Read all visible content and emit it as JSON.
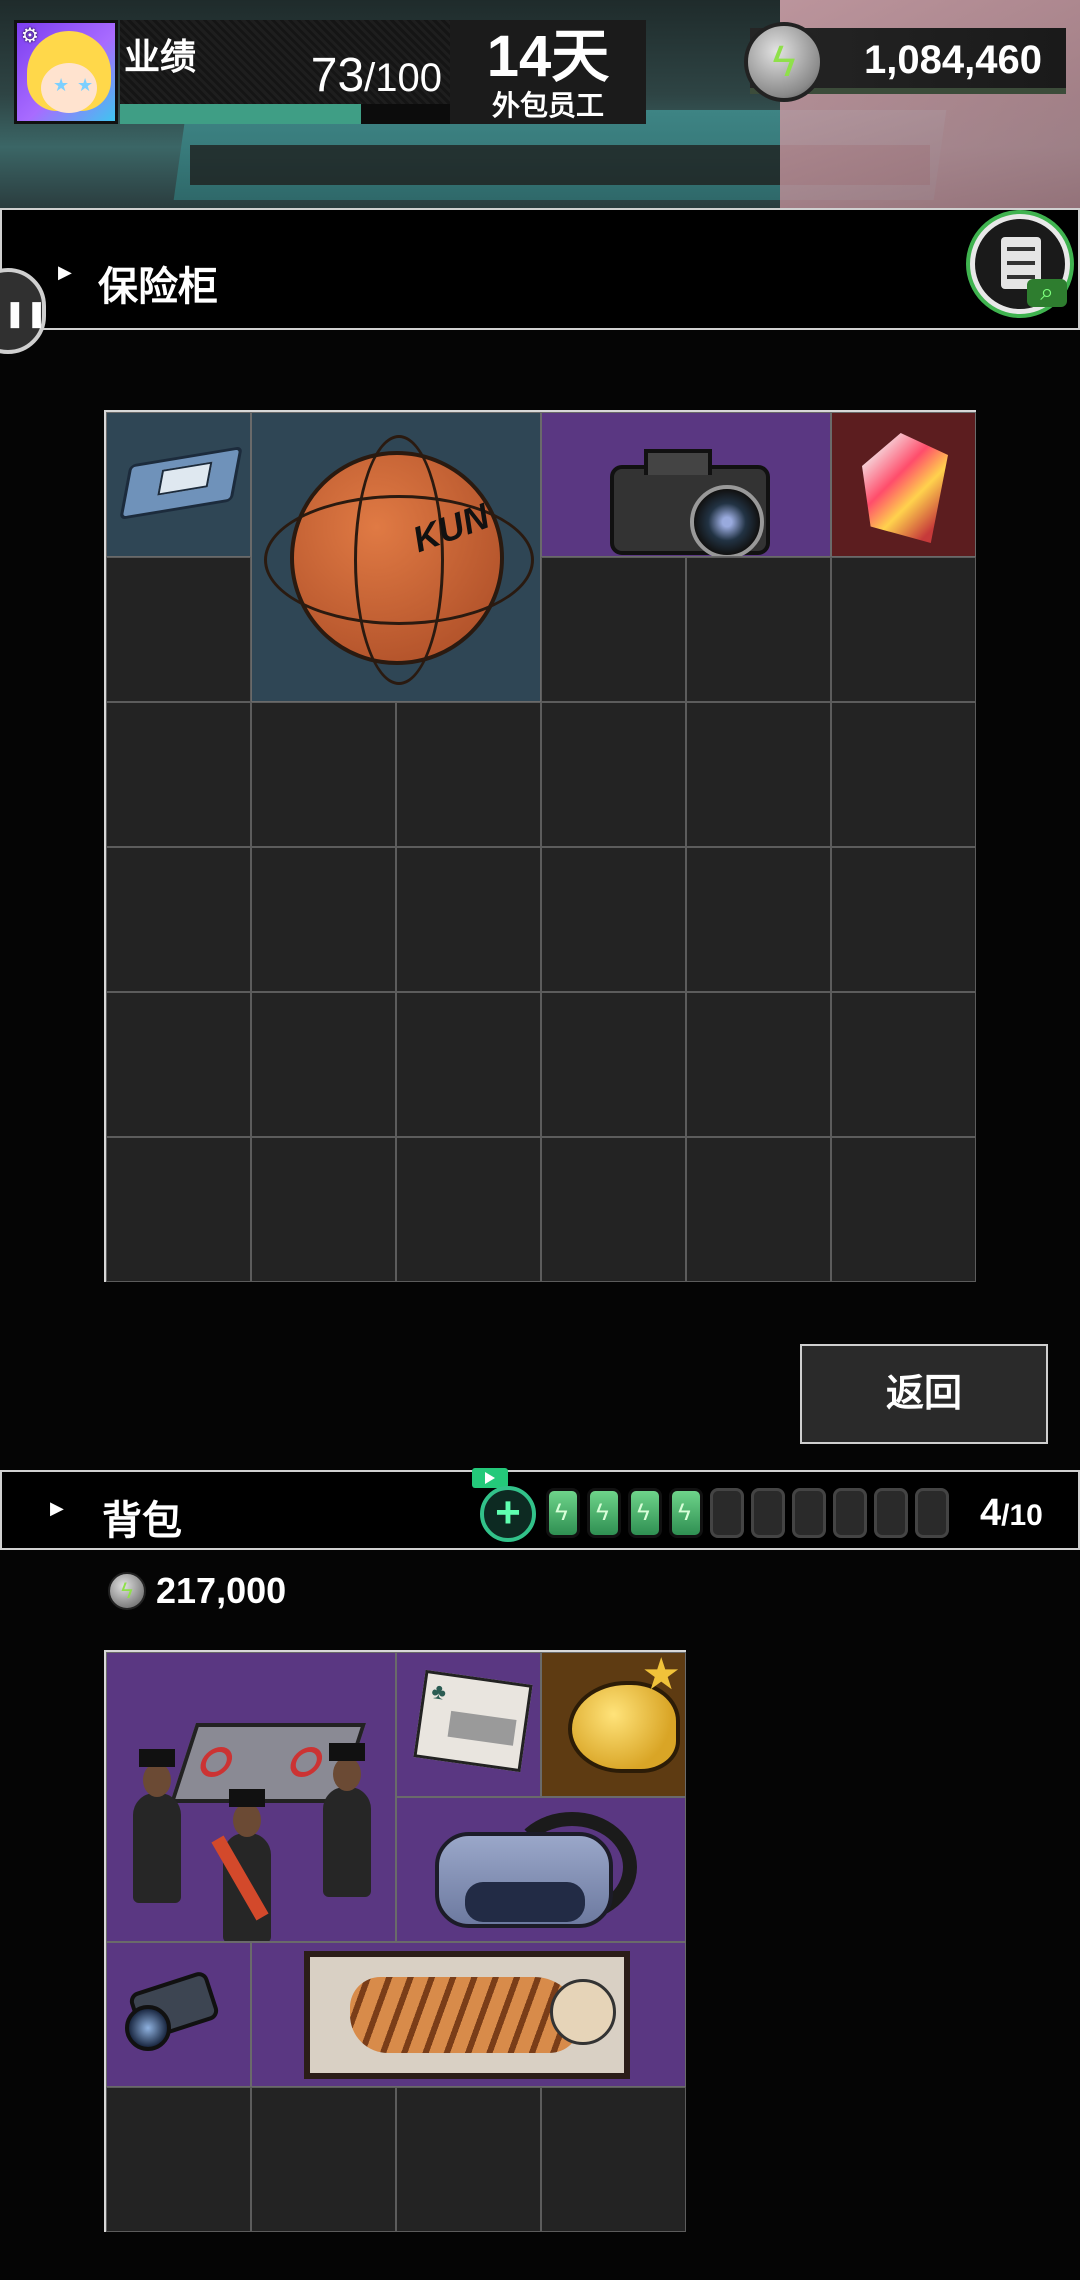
{
  "hud": {
    "performance_label": "业绩",
    "performance_current": "73",
    "performance_total": "/100",
    "performance_ratio": 0.73,
    "days": "14天",
    "role": "外包员工",
    "currency": "1,084,460"
  },
  "safe": {
    "title": "保险柜",
    "items": [
      {
        "name": "floppy-disk",
        "col": 0,
        "row": 0,
        "w": 1,
        "h": 1,
        "bg": "blue"
      },
      {
        "name": "basketball",
        "col": 1,
        "row": 0,
        "w": 2,
        "h": 2,
        "bg": "blue",
        "text": "KUN"
      },
      {
        "name": "camera",
        "col": 3,
        "row": 0,
        "w": 2,
        "h": 1,
        "bg": "purple"
      },
      {
        "name": "crystal",
        "col": 5,
        "row": 0,
        "w": 1,
        "h": 1,
        "bg": "red"
      }
    ]
  },
  "return_button": "返回",
  "bag": {
    "title": "背包",
    "money": "217,000",
    "count_current": "4",
    "count_total": "/10",
    "batteries_full": 4,
    "batteries_total": 10,
    "items": [
      {
        "name": "coffin-dance",
        "col": 0,
        "row": 0,
        "w": 2,
        "h": 2,
        "bg": "purple"
      },
      {
        "name": "travel-ticket",
        "col": 2,
        "row": 0,
        "w": 1,
        "h": 1,
        "bg": "purple"
      },
      {
        "name": "golden-bun",
        "col": 3,
        "row": 0,
        "w": 1,
        "h": 1,
        "bg": "gold",
        "starred": true
      },
      {
        "name": "vr-headset",
        "col": 2,
        "row": 1,
        "w": 2,
        "h": 1,
        "bg": "purple"
      },
      {
        "name": "rifle-scope",
        "col": 0,
        "row": 2,
        "w": 1,
        "h": 1,
        "bg": "purple"
      },
      {
        "name": "tiger-painting",
        "col": 1,
        "row": 2,
        "w": 3,
        "h": 1,
        "bg": "purple"
      }
    ]
  },
  "colors": {
    "accent_green": "#3f9e85",
    "item_blue": "#2f4655",
    "item_purple": "#5a3782",
    "item_red": "#5c1d1f",
    "item_gold": "#5e3b12"
  }
}
